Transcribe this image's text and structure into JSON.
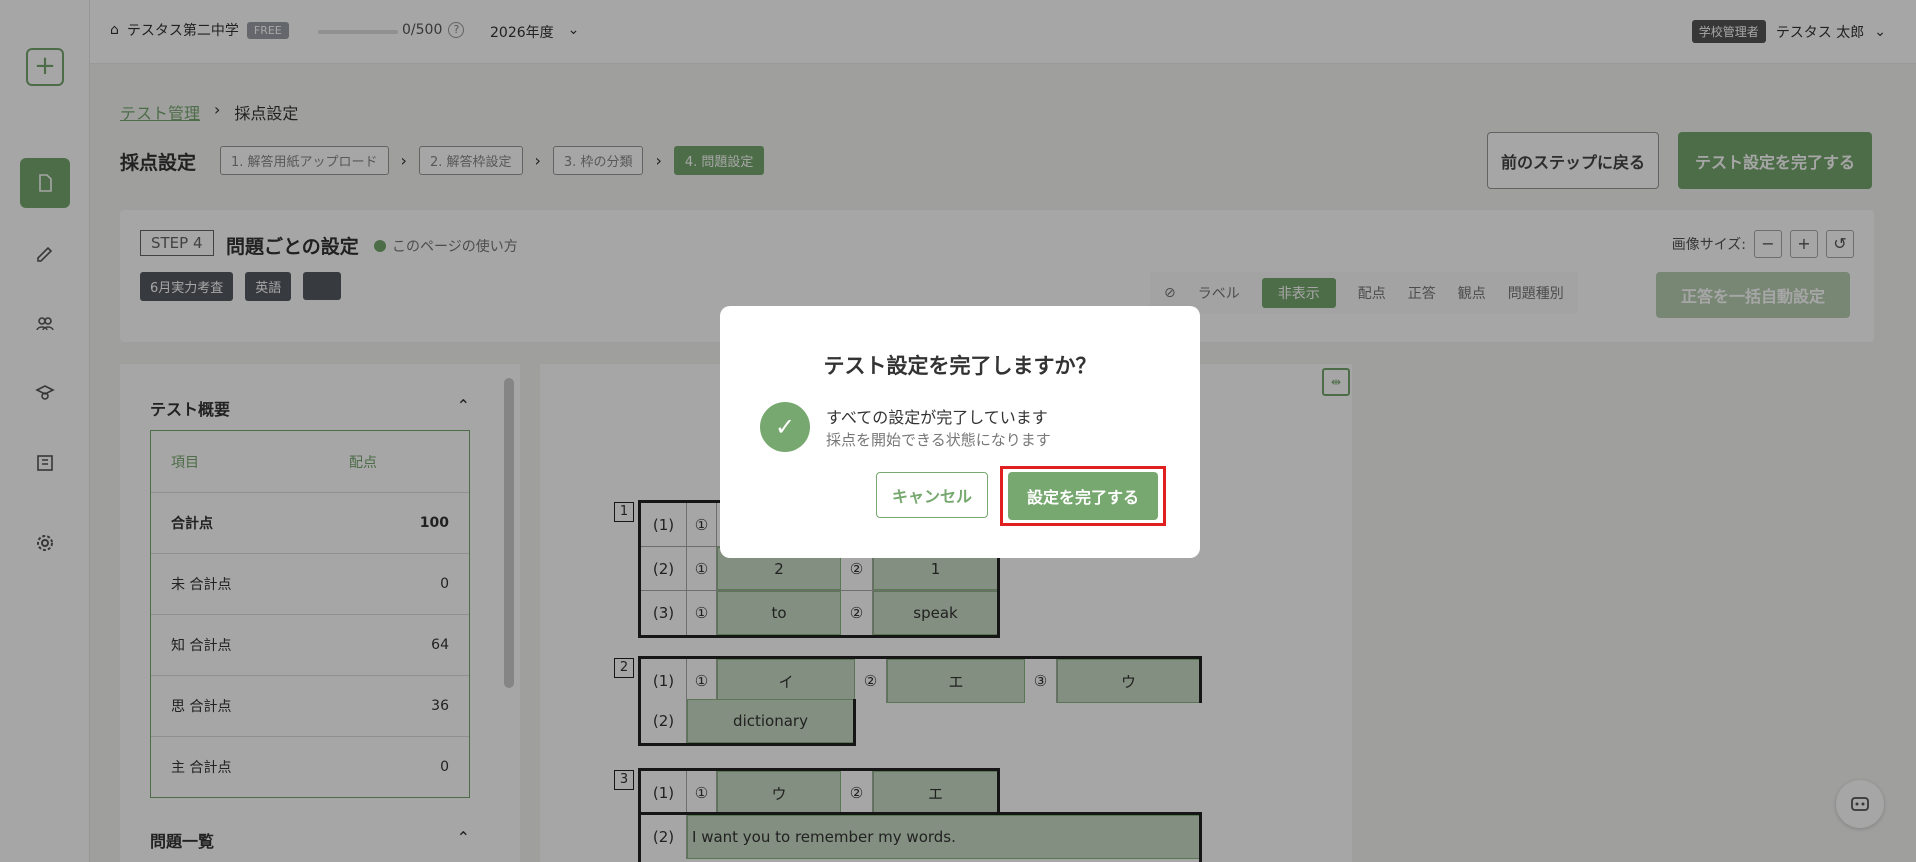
{
  "topbar": {
    "school": "テスタス第二中学",
    "plan": "FREE",
    "quota": "0/500",
    "help": "?",
    "year": "2026年度",
    "role": "学校管理者",
    "user": "テスタス 太郎"
  },
  "breadcrumb": {
    "parent": "テスト管理",
    "current": "採点設定"
  },
  "header": {
    "title": "採点設定",
    "steps": [
      "1. 解答用紙アップロード",
      "2. 解答枠設定",
      "3. 枠の分類",
      "4. 問題設定"
    ],
    "back_label": "前のステップに戻る",
    "finish_label": "テスト設定を完了する"
  },
  "step_panel": {
    "step_tag": "STEP 4",
    "title": "問題ごとの設定",
    "howto": "このページの使い方",
    "tags": [
      "6月実力考査",
      "英語"
    ],
    "image_size_label": "画像サイズ:",
    "minus": "−",
    "plus": "+",
    "reset": "↺",
    "view_label": "ラベル",
    "view_options": [
      "非表示",
      "配点",
      "正答",
      "観点",
      "問題種別"
    ],
    "auto_label": "正答を一括自動設定"
  },
  "summary": {
    "title": "テスト概要",
    "col_item": "項目",
    "col_score": "配点",
    "rows": [
      {
        "label": "合計点",
        "value": "100"
      },
      {
        "label": "未 合計点",
        "value": "0"
      },
      {
        "label": "知 合計点",
        "value": "64"
      },
      {
        "label": "思 合計点",
        "value": "36"
      },
      {
        "label": "主 合計点",
        "value": "0"
      }
    ],
    "list_title": "問題一覧"
  },
  "sheet": {
    "q1": {
      "num": "1",
      "r1": [
        "(1)",
        "①"
      ],
      "r2": [
        "(2)",
        "①",
        "2",
        "②",
        "1"
      ],
      "r3": [
        "(3)",
        "①",
        "to",
        "②",
        "speak"
      ]
    },
    "q2": {
      "num": "2",
      "r1": [
        "(1)",
        "①",
        "イ",
        "②",
        "エ",
        "③",
        "ウ"
      ],
      "r2": [
        "(2)",
        "dictionary"
      ]
    },
    "q3": {
      "num": "3",
      "r1": [
        "(1)",
        "①",
        "ウ",
        "②",
        "エ"
      ],
      "r2": [
        "(2)",
        "I want you to remember my words."
      ]
    }
  },
  "modal": {
    "title": "テスト設定を完了しますか？",
    "check": "✓",
    "message": "すべての設定が完了しています",
    "sub": "採点を開始できる状態になります",
    "cancel": "キャンセル",
    "confirm": "設定を完了する"
  },
  "colors": {
    "accent": "#77a86f",
    "highlight": "#e02020"
  }
}
